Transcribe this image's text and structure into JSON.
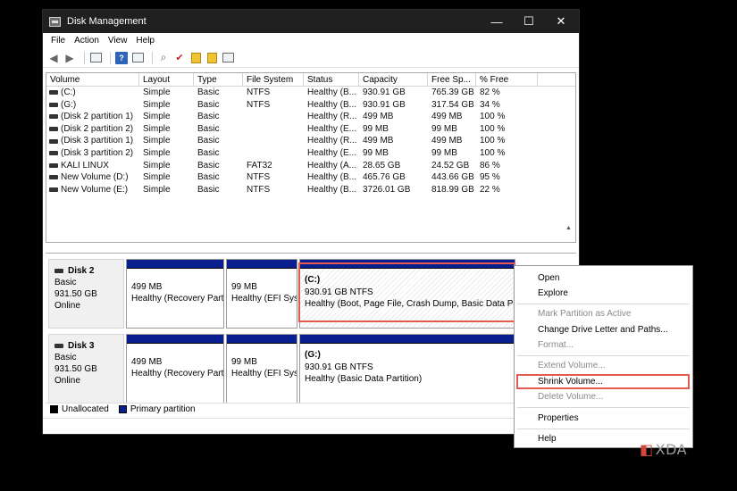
{
  "window": {
    "title": "Disk Management",
    "minimize_glyph": "—",
    "maximize_glyph": "☐",
    "close_glyph": "✕"
  },
  "menu": {
    "items": [
      "File",
      "Action",
      "View",
      "Help"
    ]
  },
  "toolbar": {
    "icons": [
      "back-arrow-icon",
      "forward-arrow-icon",
      "console-tree-icon",
      "help-icon",
      "properties-icon",
      "rescan-icon",
      "checklist-icon",
      "folder-up-icon",
      "folder-icon",
      "list-view-icon"
    ]
  },
  "volume_list": {
    "columns": [
      "Volume",
      "Layout",
      "Type",
      "File System",
      "Status",
      "Capacity",
      "Free Sp...",
      "% Free"
    ],
    "rows": [
      [
        "(C:)",
        "Simple",
        "Basic",
        "NTFS",
        "Healthy (B...",
        "930.91 GB",
        "765.39 GB",
        "82 %"
      ],
      [
        "(G:)",
        "Simple",
        "Basic",
        "NTFS",
        "Healthy (B...",
        "930.91 GB",
        "317.54 GB",
        "34 %"
      ],
      [
        "(Disk 2 partition 1)",
        "Simple",
        "Basic",
        "",
        "Healthy (R...",
        "499 MB",
        "499 MB",
        "100 %"
      ],
      [
        "(Disk 2 partition 2)",
        "Simple",
        "Basic",
        "",
        "Healthy (E...",
        "99 MB",
        "99 MB",
        "100 %"
      ],
      [
        "(Disk 3 partition 1)",
        "Simple",
        "Basic",
        "",
        "Healthy (R...",
        "499 MB",
        "499 MB",
        "100 %"
      ],
      [
        "(Disk 3 partition 2)",
        "Simple",
        "Basic",
        "",
        "Healthy (E...",
        "99 MB",
        "99 MB",
        "100 %"
      ],
      [
        "KALI LINUX",
        "Simple",
        "Basic",
        "FAT32",
        "Healthy (A...",
        "28.65 GB",
        "24.52 GB",
        "86 %"
      ],
      [
        "New Volume (D:)",
        "Simple",
        "Basic",
        "NTFS",
        "Healthy (B...",
        "465.76 GB",
        "443.66 GB",
        "95 %"
      ],
      [
        "New Volume (E:)",
        "Simple",
        "Basic",
        "NTFS",
        "Healthy (B...",
        "3726.01 GB",
        "818.99 GB",
        "22 %"
      ]
    ]
  },
  "disks": [
    {
      "name": "Disk 2",
      "type": "Basic",
      "size": "931.50 GB",
      "state": "Online",
      "partitions": [
        {
          "title": "",
          "line1": "499 MB",
          "line2": "Healthy (Recovery Parti"
        },
        {
          "title": "",
          "line1": "99 MB",
          "line2": "Healthy (EFI Syst"
        },
        {
          "title": "(C:)",
          "line1": "930.91 GB NTFS",
          "line2": "Healthy (Boot, Page File, Crash Dump, Basic Data Partit"
        }
      ]
    },
    {
      "name": "Disk 3",
      "type": "Basic",
      "size": "931.50 GB",
      "state": "Online",
      "partitions": [
        {
          "title": "",
          "line1": "499 MB",
          "line2": "Healthy (Recovery Parti"
        },
        {
          "title": "",
          "line1": "99 MB",
          "line2": "Healthy (EFI Syst"
        },
        {
          "title": "(G:)",
          "line1": "930.91 GB NTFS",
          "line2": "Healthy (Basic Data Partition)"
        }
      ]
    }
  ],
  "legend": [
    {
      "label": "Unallocated",
      "color": "#000000"
    },
    {
      "label": "Primary partition",
      "color": "#0a1f8f"
    }
  ],
  "context_menu": {
    "items": [
      {
        "label": "Open",
        "enabled": true
      },
      {
        "label": "Explore",
        "enabled": true
      },
      {
        "label": "Mark Partition as Active",
        "enabled": false
      },
      {
        "label": "Change Drive Letter and Paths...",
        "enabled": true
      },
      {
        "label": "Format...",
        "enabled": false
      },
      {
        "label": "Extend Volume...",
        "enabled": false
      },
      {
        "label": "Shrink Volume...",
        "enabled": true,
        "highlighted": true
      },
      {
        "label": "Delete Volume...",
        "enabled": false
      },
      {
        "label": "Properties",
        "enabled": true
      },
      {
        "label": "Help",
        "enabled": true
      }
    ]
  },
  "colors": {
    "highlight_outline": "#e35a4f",
    "partition_bar": "#0a1f8f"
  },
  "watermark": {
    "mark": "◧",
    "text": "XDA"
  }
}
